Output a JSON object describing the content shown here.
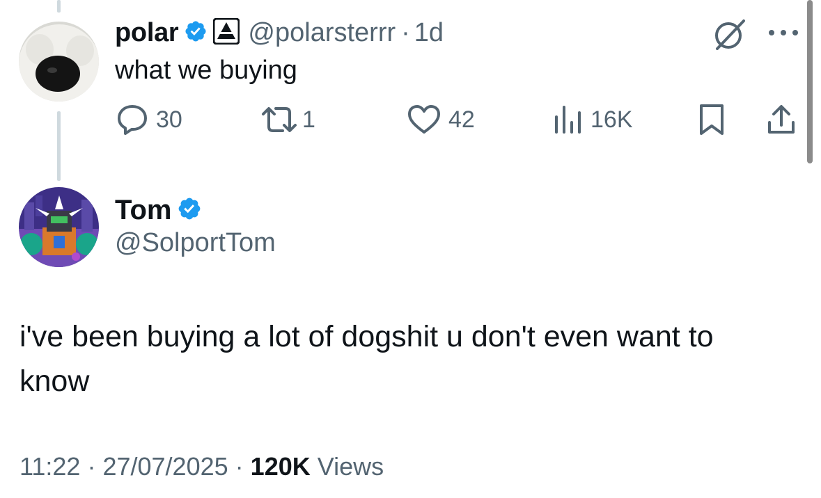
{
  "parent": {
    "name": "polar",
    "handle": "@polarsterrr",
    "dot": "·",
    "time": "1d",
    "text": "what we buying",
    "stats": {
      "replies": "30",
      "reposts": "1",
      "likes": "42",
      "views": "16K"
    }
  },
  "reply": {
    "name": "Tom",
    "handle": "@SolportTom",
    "text": "i've been buying a lot of dogshit u don't even want to know",
    "footer": {
      "time": "11:22",
      "sep1": "·",
      "date": "27/07/2025",
      "sep2": "·",
      "views_count": "120K",
      "views_label": "Views"
    }
  },
  "icons": {
    "verified": "verified-badge-icon",
    "affiliate": "affiliate-badge-icon",
    "grok": "grok-icon",
    "more": "more-icon",
    "reply": "reply-icon",
    "repost": "repost-icon",
    "like": "like-icon",
    "views": "views-icon",
    "bookmark": "bookmark-icon",
    "share": "share-icon"
  },
  "colors": {
    "verified_blue": "#1d9bf0",
    "muted_text": "#536471",
    "primary_text": "#0f1419",
    "thread_line": "#cfd9de"
  }
}
